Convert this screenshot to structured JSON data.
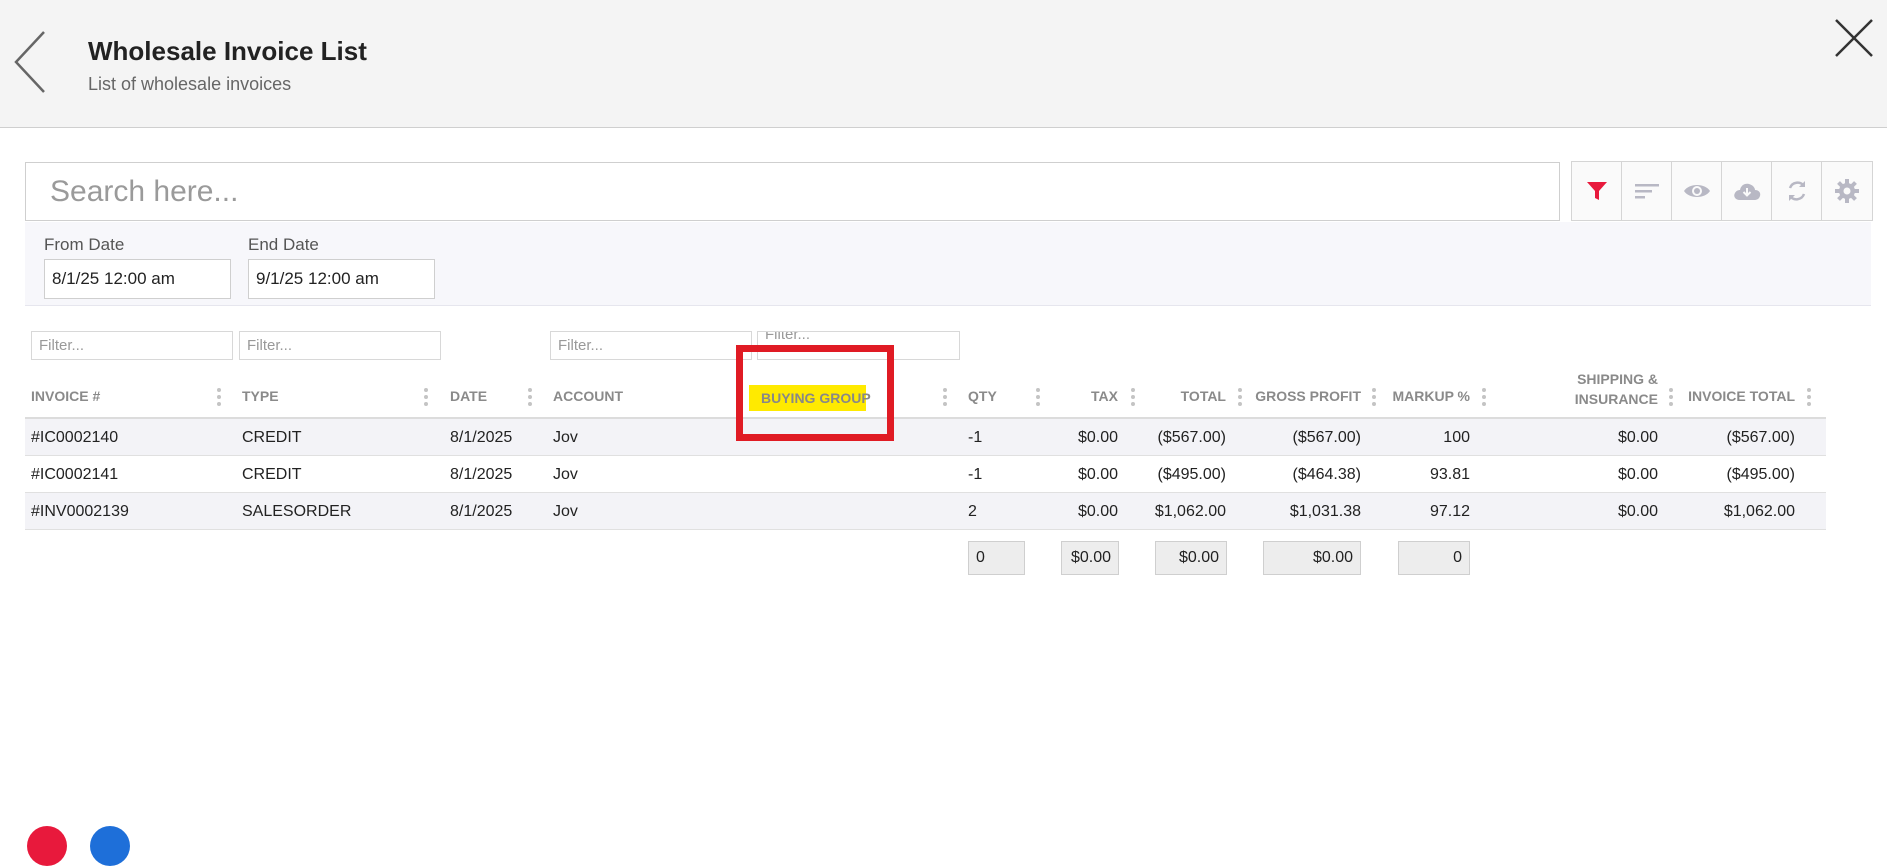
{
  "header": {
    "title": "Wholesale Invoice List",
    "subtitle": "List of wholesale invoices"
  },
  "search": {
    "placeholder": "Search here..."
  },
  "toolbar": {
    "buttons": [
      "filter-icon",
      "sort-icon",
      "eye-icon",
      "cloud-download-icon",
      "refresh-icon",
      "gear-icon"
    ],
    "active_color": "#e8193c",
    "icon_color": "#b8b8c4"
  },
  "date_filters": {
    "from_label": "From Date",
    "from_value": "8/1/25 12:00 am",
    "end_label": "End Date",
    "end_value": "9/1/25 12:00 am"
  },
  "column_filters": {
    "placeholder": "Filter...",
    "partial_placeholder": "Filter..."
  },
  "table": {
    "columns": {
      "invoice": "INVOICE #",
      "type": "TYPE",
      "date": "DATE",
      "account": "ACCOUNT",
      "buying_group": "BUYING GROUP",
      "qty": "QTY",
      "tax": "TAX",
      "total": "TOTAL",
      "gross_profit": "GROSS PROFIT",
      "markup": "MARKUP %",
      "shipping_line1": "SHIPPING &",
      "shipping_line2": "INSURANCE",
      "invoice_total": "INVOICE TOTAL"
    },
    "rows": [
      {
        "invoice": "#IC0002140",
        "type": "CREDIT",
        "date": "8/1/2025",
        "account": "Jov",
        "buying_group": "",
        "qty": "-1",
        "tax": "$0.00",
        "total": "($567.00)",
        "gross_profit": "($567.00)",
        "markup": "100",
        "shipping": "$0.00",
        "invoice_total": "($567.00)"
      },
      {
        "invoice": "#IC0002141",
        "type": "CREDIT",
        "date": "8/1/2025",
        "account": "Jov",
        "buying_group": "",
        "qty": "-1",
        "tax": "$0.00",
        "total": "($495.00)",
        "gross_profit": "($464.38)",
        "markup": "93.81",
        "shipping": "$0.00",
        "invoice_total": "($495.00)"
      },
      {
        "invoice": "#INV0002139",
        "type": "SALESORDER",
        "date": "8/1/2025",
        "account": "Jov",
        "buying_group": "",
        "qty": "2",
        "tax": "$0.00",
        "total": "$1,062.00",
        "gross_profit": "$1,031.38",
        "markup": "97.12",
        "shipping": "$0.00",
        "invoice_total": "$1,062.00"
      }
    ],
    "totals": {
      "qty": "0",
      "tax": "$0.00",
      "total": "$0.00",
      "gross_profit": "$0.00",
      "markup": "0"
    }
  },
  "annotation": {
    "highlight_color": "#ffea00",
    "box_color": "#e01b24"
  }
}
